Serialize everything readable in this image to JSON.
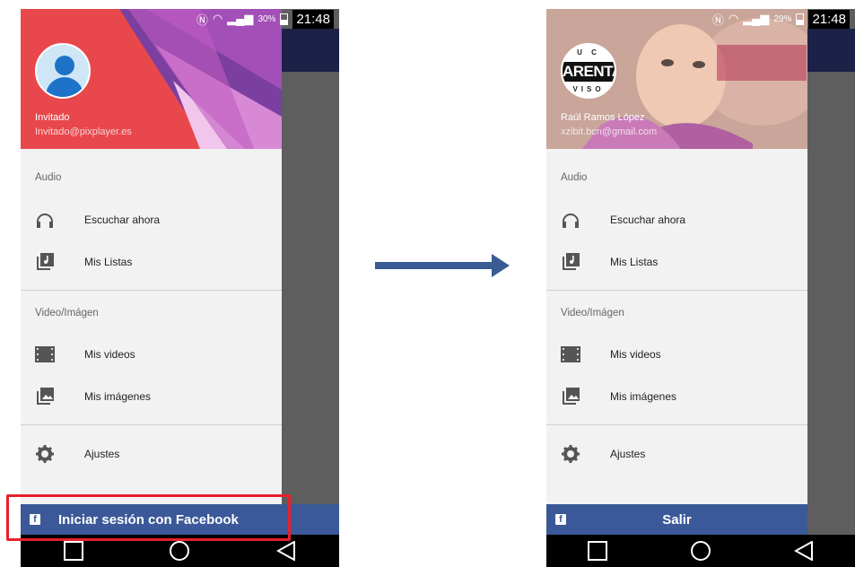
{
  "status_left": {
    "battery": "30%",
    "time": "21:48"
  },
  "status_right": {
    "battery": "29%",
    "time": "21:48"
  },
  "left": {
    "user_name": "Invitado",
    "user_email": "Invitado@pixplayer.es",
    "section_audio": "Audio",
    "escuchar": "Escuchar ahora",
    "listas": "Mis Listas",
    "section_video": "Video/Imágen",
    "videos": "Mis videos",
    "imagenes": "Mis imágenes",
    "ajustes": "Ajustes",
    "facebook_button": "Iniciar sesión con Facebook"
  },
  "right": {
    "logo_top": "U C",
    "logo_band": "ARENTA",
    "logo_bottom": "VISO",
    "user_name": "Raúl Ramos López",
    "user_email": "xzibit.bcn@gmail.com",
    "section_audio": "Audio",
    "escuchar": "Escuchar ahora",
    "listas": "Mis Listas",
    "section_video": "Video/Imágen",
    "videos": "Mis videos",
    "imagenes": "Mis imágenes",
    "ajustes": "Ajustes",
    "salir_button": "Salir"
  },
  "colors": {
    "facebook_blue": "#3b5998",
    "highlight_red": "#e8202a",
    "arrow_blue": "#3a5c95",
    "appbar_navy": "#1c2147"
  }
}
